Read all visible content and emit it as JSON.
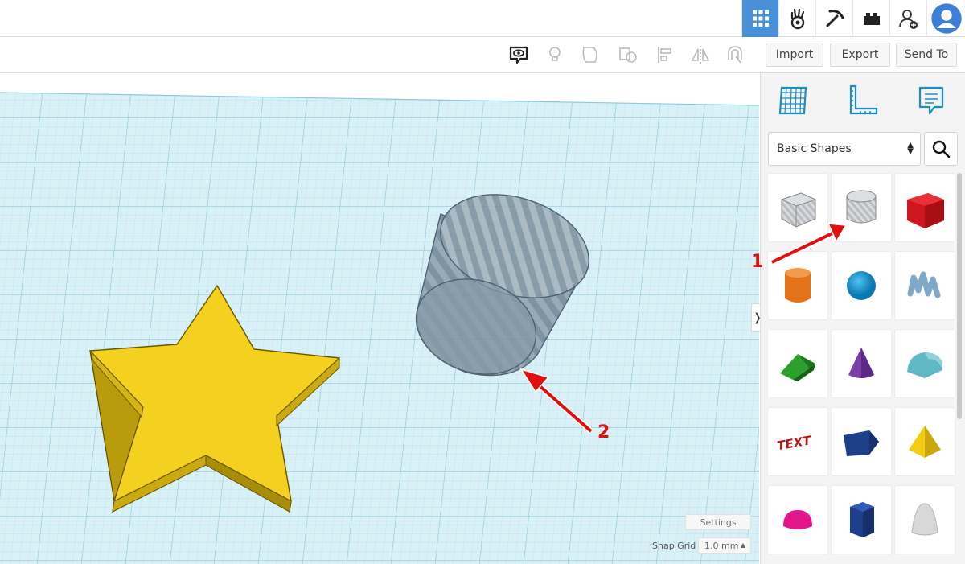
{
  "toolbar": {
    "import_label": "Import",
    "export_label": "Export",
    "send_label": "Send To"
  },
  "panel": {
    "category_select": "Basic Shapes",
    "shapes": [
      "box-hole",
      "cylinder-hole",
      "box",
      "cylinder",
      "sphere",
      "scribble",
      "roof",
      "cone",
      "round-roof",
      "text",
      "half-sphere-wedge",
      "pyramid",
      "half-sphere",
      "polygon",
      "paraboloid"
    ]
  },
  "workplane": {
    "settings_label": "Settings",
    "snap_grid_label": "Snap Grid",
    "snap_grid_value": "1.0 mm"
  },
  "annotations": {
    "arrow_1_label": "1",
    "arrow_2_label": "2"
  },
  "colors": {
    "accent": "#4a90d9",
    "grid_bg": "#d5edf5",
    "grid_line": "#9fd0e2",
    "star": "#f5d11f",
    "annotation": "#e01010"
  }
}
